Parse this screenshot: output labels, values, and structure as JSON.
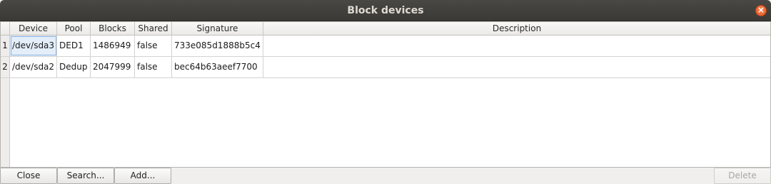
{
  "window": {
    "title": "Block devices",
    "close_glyph": "×"
  },
  "table": {
    "columns": [
      "Device",
      "Pool",
      "Blocks",
      "Shared",
      "Signature",
      "Description"
    ],
    "rows": [
      {
        "num": "1",
        "device": "/dev/sda3",
        "pool": "DED1",
        "blocks": "1486949",
        "shared": "false",
        "signature": "733e085d1888b5c4",
        "description": ""
      },
      {
        "num": "2",
        "device": "/dev/sda2",
        "pool": "Dedup",
        "blocks": "2047999",
        "shared": "false",
        "signature": "bec64b63aeef7700",
        "description": ""
      }
    ],
    "selected_cell": "row 1, Device"
  },
  "buttons": {
    "close": "Close",
    "search": "Search...",
    "add": "Add...",
    "delete": "Delete"
  },
  "colors": {
    "titlebar": "#3b3936",
    "close_button": "#e0531f",
    "selection": "#e3eefa"
  },
  "icons": {
    "window_close": "close-icon"
  }
}
